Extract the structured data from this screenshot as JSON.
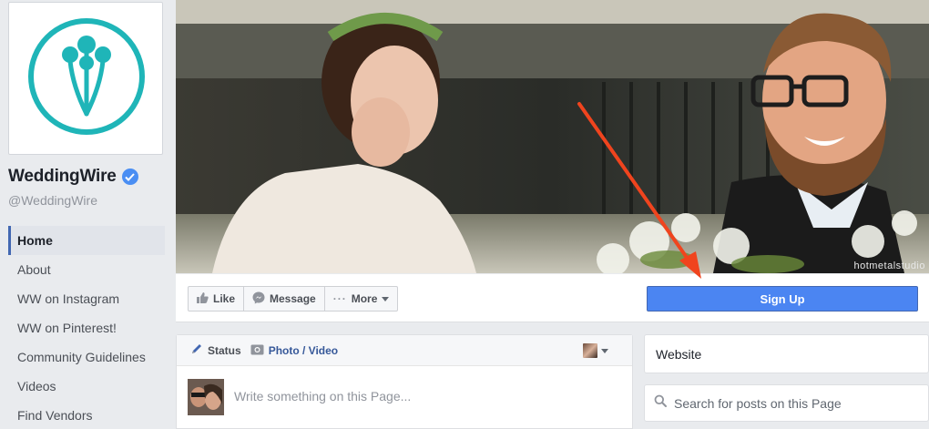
{
  "page": {
    "name": "WeddingWire",
    "handle": "@WeddingWire",
    "verified": true
  },
  "nav": {
    "items": [
      {
        "label": "Home",
        "active": true
      },
      {
        "label": "About"
      },
      {
        "label": "WW on Instagram"
      },
      {
        "label": "WW on Pinterest!"
      },
      {
        "label": "Community Guidelines"
      },
      {
        "label": "Videos"
      },
      {
        "label": "Find Vendors"
      }
    ]
  },
  "cover": {
    "watermark": "hotmetalstudio"
  },
  "actions": {
    "like": "Like",
    "message": "Message",
    "more": "More",
    "signup": "Sign Up"
  },
  "composer": {
    "status_tab": "Status",
    "photo_tab": "Photo / Video",
    "placeholder": "Write something on this Page..."
  },
  "sidebar_right": {
    "website": "Website",
    "search_placeholder": "Search for posts on this Page"
  },
  "colors": {
    "brand_teal": "#1fb5b8",
    "facebook_blue": "#4267b2",
    "signup_blue": "#4b85f2",
    "arrow_red": "#f0441e"
  }
}
